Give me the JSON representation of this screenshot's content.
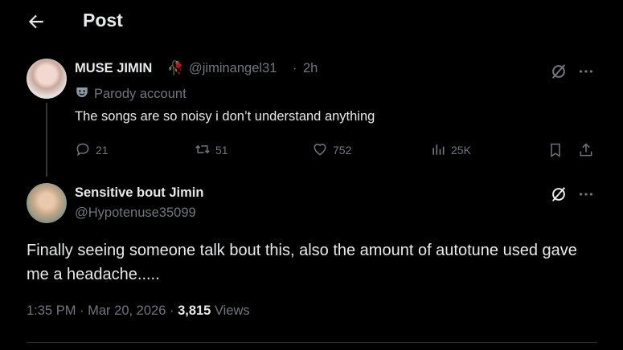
{
  "header": {
    "title": "Post",
    "back_icon": "arrow-left-icon"
  },
  "parent_post": {
    "display_name": "MUSE JIMIN",
    "name_emoji": "🥀",
    "handle": "@jiminangel31",
    "separator": "·",
    "time_ago": "2h",
    "parody_label": "Parody account",
    "parody_icon": "theater-mask-icon",
    "text": "The songs are so noisy i don’t understand anything",
    "stats": {
      "replies": "21",
      "reposts": "51",
      "likes": "752",
      "views": "25K"
    }
  },
  "reply_post": {
    "display_name": "Sensitive bout Jimin",
    "handle": "@Hypotenuse35099",
    "text": "Finally seeing someone talk bout this, also the amount of autotune used gave me a headache.....",
    "time": "1:35 PM",
    "date": "Mar 20, 2026",
    "separator": "·",
    "view_count": "3,815",
    "views_label": "Views"
  },
  "colors": {
    "background": "#000000",
    "primary_text": "#e7e9ea",
    "secondary_text": "#71767b",
    "divider": "#2f3336"
  }
}
